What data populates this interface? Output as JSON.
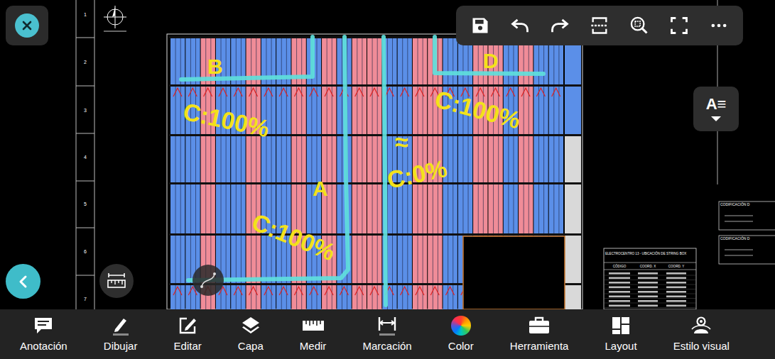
{
  "drawing": {
    "row_numbers": [
      "1",
      "2",
      "3",
      "4",
      "5",
      "6",
      "7"
    ],
    "columns": [
      {
        "color": "#5b8fe8"
      },
      {
        "color": "#5b8fe8"
      },
      {
        "color": "#f08c98"
      },
      {
        "color": "#5b8fe8"
      },
      {
        "color": "#5b8fe8"
      },
      {
        "color": "#f08c98"
      },
      {
        "color": "#5b8fe8"
      },
      {
        "color": "#5b8fe8"
      },
      {
        "color": "#f08c98"
      },
      {
        "color": "#5b8fe8"
      },
      {
        "color": "#f08c98"
      },
      {
        "color": "#5b8fe8"
      },
      {
        "color": "#f08c98"
      },
      {
        "color": "#f08c98"
      },
      {
        "color": "#5b8fe8"
      },
      {
        "color": "#5b8fe8"
      },
      {
        "color": "#f08c98"
      },
      {
        "color": "#f08c98"
      },
      {
        "color": "#5b8fe8"
      },
      {
        "color": "#5b8fe8"
      },
      {
        "color": "#f08c98"
      },
      {
        "color": "#f08c98"
      },
      {
        "color": "#5b8fe8"
      },
      {
        "color": "#f08c98"
      },
      {
        "color": "#5b8fe8"
      },
      {
        "color": "#5b8fe8"
      }
    ],
    "string_box_table": {
      "title": "ELECTROCENTRO 13 - UBICACIÓN DE STRING BOX",
      "headers": [
        "CÓDIGO",
        "COORD. X",
        "COORD. Y"
      ]
    },
    "legend": [
      "CODIFICACIÓN D",
      "CODIFICACIÓN D"
    ],
    "annotations": [
      {
        "text": "B"
      },
      {
        "text": "C:100%"
      },
      {
        "text": "A"
      },
      {
        "text": "C:100%"
      },
      {
        "text": "≈"
      },
      {
        "text": "C:0%"
      },
      {
        "text": "D"
      },
      {
        "text": "C:100%"
      }
    ]
  },
  "text_style_button": {
    "label": "A≡"
  },
  "bottom_toolbar": [
    {
      "label": "Anotación"
    },
    {
      "label": "Dibujar"
    },
    {
      "label": "Editar"
    },
    {
      "label": "Capa"
    },
    {
      "label": "Medir"
    },
    {
      "label": "Marcación"
    },
    {
      "label": "Color"
    },
    {
      "label": "Herramienta"
    },
    {
      "label": "Layout"
    },
    {
      "label": "Estilo visual"
    }
  ]
}
